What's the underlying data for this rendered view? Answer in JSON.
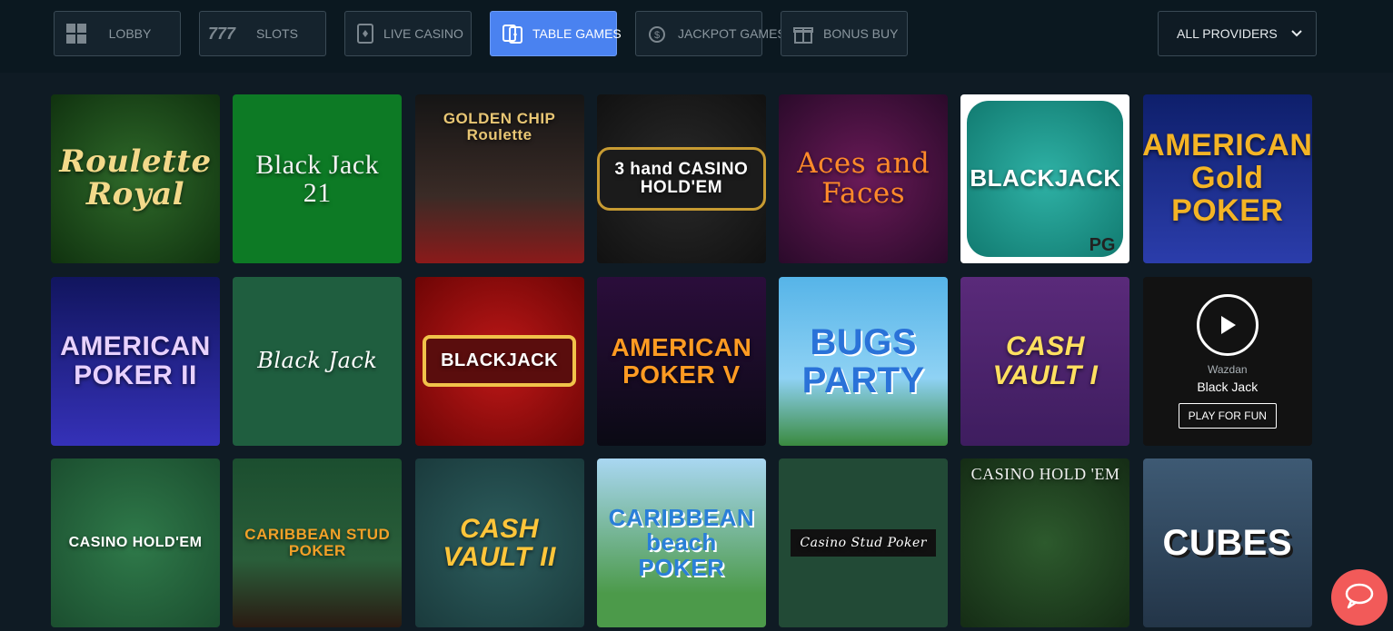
{
  "nav": {
    "tabs": [
      {
        "label": "LOBBY",
        "icon": "grid-icon"
      },
      {
        "label": "SLOTS",
        "icon": "sevens-icon"
      },
      {
        "label": "LIVE CASINO",
        "icon": "card-icon"
      },
      {
        "label": "TABLE GAMES",
        "icon": "cards-icon",
        "active": true
      },
      {
        "label": "JACKPOT GAMES",
        "icon": "money-icon"
      },
      {
        "label": "BONUS BUY",
        "icon": "gift-icon"
      }
    ],
    "providers_label": "ALL PROVIDERS"
  },
  "games": [
    {
      "title": "Roulette Royal"
    },
    {
      "title": "Black Jack 21"
    },
    {
      "title": "GOLDEN CHIP Roulette"
    },
    {
      "title": "3 hand CASINO HOLD'EM"
    },
    {
      "title": "Aces and Faces"
    },
    {
      "title": "BLACKJACK",
      "badge": "PG"
    },
    {
      "title": "AMERICAN Gold POKER"
    },
    {
      "title": "AMERICAN POKER II"
    },
    {
      "title": "Black Jack"
    },
    {
      "title": "BLACKJACK"
    },
    {
      "title": "AMERICAN POKER V"
    },
    {
      "title": "BUGS PARTY"
    },
    {
      "title": "CASH VAULT I"
    },
    {
      "title": "Black Jack",
      "provider": "Wazdan",
      "cta": "PLAY FOR FUN"
    },
    {
      "title": "CASINO HOLD'EM"
    },
    {
      "title": "CARIBBEAN STUD POKER"
    },
    {
      "title": "CASH VAULT II"
    },
    {
      "title": "CARIBBEAN beach POKER"
    },
    {
      "title": "Casino Stud Poker"
    },
    {
      "title": "CASINO HOLD 'EM"
    },
    {
      "title": "CUBES"
    }
  ],
  "colors": {
    "accent": "#4a82f0",
    "chat": "#f25a59",
    "background": "#0f1b24"
  }
}
